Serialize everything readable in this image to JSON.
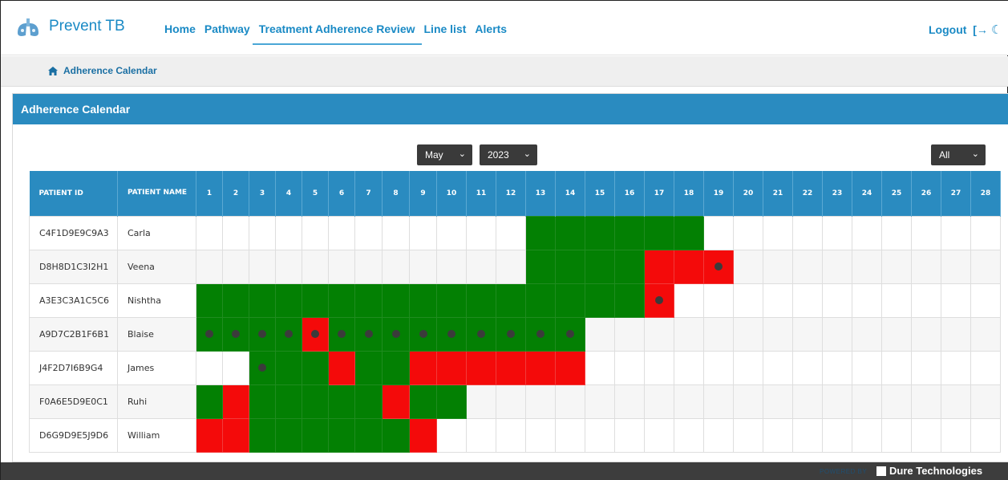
{
  "app": {
    "brand": "Prevent TB"
  },
  "nav": {
    "links": [
      "Home",
      "Pathway",
      "Treatment Adherence Review",
      "Line list",
      "Alerts"
    ],
    "active_index": 2,
    "logout": "Logout",
    "logout_icon": "logout-arrow-icon",
    "theme_icon": "moon-icon"
  },
  "breadcrumb": {
    "label": "Adherence Calendar",
    "icon": "home-icon"
  },
  "panel": {
    "title": "Adherence Calendar"
  },
  "filters": {
    "month": "May",
    "year": "2023",
    "view": "All"
  },
  "table": {
    "headers": {
      "id": "PATIENT ID",
      "name": "PATIENT NAME"
    },
    "days": [
      "1",
      "2",
      "3",
      "4",
      "5",
      "6",
      "7",
      "8",
      "9",
      "10",
      "11",
      "12",
      "13",
      "14",
      "15",
      "16",
      "17",
      "18",
      "19",
      "20",
      "21",
      "22",
      "23",
      "24",
      "25",
      "26",
      "27",
      "28"
    ],
    "legend_colors": {
      "g": "#038003",
      "r": "#f40a0a",
      "dot": "#3b3b3b"
    },
    "rows": [
      {
        "id": "C4F1D9E9C9A3",
        "name": "Carla",
        "days": [
          "",
          "",
          "",
          "",
          "",
          "",
          "",
          "",
          "",
          "",
          "",
          "",
          "g",
          "g",
          "g",
          "g",
          "g",
          "g",
          "",
          "",
          "",
          "",
          "",
          "",
          "",
          "",
          "",
          ""
        ]
      },
      {
        "id": "D8H8D1C3I2H1",
        "name": "Veena",
        "days": [
          "",
          "",
          "",
          "",
          "",
          "",
          "",
          "",
          "",
          "",
          "",
          "",
          "g",
          "g",
          "g",
          "g",
          "r",
          "r",
          "r.",
          "",
          "",
          "",
          "",
          "",
          "",
          "",
          "",
          ""
        ]
      },
      {
        "id": "A3E3C3A1C5C6",
        "name": "Nishtha",
        "days": [
          "g",
          "g",
          "g",
          "g",
          "g",
          "g",
          "g",
          "g",
          "g",
          "g",
          "g",
          "g",
          "g",
          "g",
          "g",
          "g",
          "r.",
          "",
          "",
          "",
          "",
          "",
          "",
          "",
          "",
          "",
          "",
          ""
        ]
      },
      {
        "id": "A9D7C2B1F6B1",
        "name": "Blaise",
        "days": [
          "g.",
          "g.",
          "g.",
          "g.",
          "r.",
          "g.",
          "g.",
          "g.",
          "g.",
          "g.",
          "g.",
          "g.",
          "g.",
          "g.",
          "",
          "",
          "",
          "",
          "",
          "",
          "",
          "",
          "",
          "",
          "",
          "",
          "",
          ""
        ]
      },
      {
        "id": "J4F2D7I6B9G4",
        "name": "James",
        "days": [
          "",
          "",
          "g.",
          "g",
          "g",
          "r",
          "g",
          "g",
          "r",
          "r",
          "r",
          "r",
          "r",
          "r",
          "",
          "",
          "",
          "",
          "",
          "",
          "",
          "",
          "",
          "",
          "",
          "",
          "",
          ""
        ]
      },
      {
        "id": "F0A6E5D9E0C1",
        "name": "Ruhi",
        "days": [
          "g",
          "r",
          "g",
          "g",
          "g",
          "g",
          "g",
          "r",
          "g",
          "g",
          "",
          "",
          "",
          "",
          "",
          "",
          "",
          "",
          "",
          "",
          "",
          "",
          "",
          "",
          "",
          "",
          "",
          ""
        ]
      },
      {
        "id": "D6G9D9E5J9D6",
        "name": "William",
        "days": [
          "r",
          "r",
          "g",
          "g",
          "g",
          "g",
          "g",
          "g",
          "r",
          "",
          "",
          "",
          "",
          "",
          "",
          "",
          "",
          "",
          "",
          "",
          "",
          "",
          "",
          "",
          "",
          "",
          "",
          ""
        ]
      }
    ]
  },
  "footer": {
    "powered": "POWERED BY",
    "company": "Dure Technologies"
  }
}
